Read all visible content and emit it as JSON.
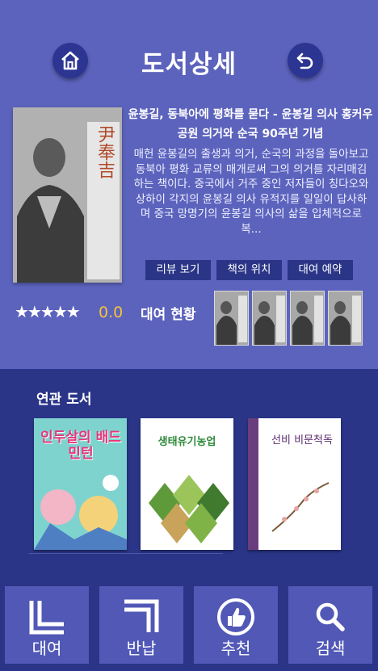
{
  "header": {
    "title": "도서상세"
  },
  "book": {
    "title": "윤봉길, 동북아에 평화를 묻다 - 윤봉길 의사 홍커우 공원 의거와 순국 90주년 기념",
    "description": "매헌 윤봉길의 출생과 의거, 순국의 과정을 돌아보고 동북아 평화 교류의 매개로써 그의 의거를 자리매김하는 책이다. 중국에서 거주 중인 저자들이 칭다오와 상하이 각지의 윤봉길 의사 유적지를 일일이 답사하며 중국 망명기의 윤봉길 의사의 삶을 입체적으로 복...",
    "cover_text": "尹奉吉"
  },
  "actions": {
    "review": "리뷰 보기",
    "location": "책의 위치",
    "reserve": "대여 예약"
  },
  "rating": {
    "stars": "★★★★★",
    "value": "0.0"
  },
  "rental_status_label": "대여 현황",
  "related": {
    "label": "연관 도서",
    "books": [
      {
        "cover_text": "인두살의 배드민턴"
      },
      {
        "cover_text": "생태유기농업"
      },
      {
        "cover_text": "선비 비문척독"
      }
    ]
  },
  "nav": {
    "rent": "대여",
    "return": "반납",
    "recommend": "추천",
    "search": "검색"
  },
  "colors": {
    "top_bg": "#5c63bd",
    "bottom_bg": "#2a3587",
    "accent": "#f7c23a"
  },
  "icons": [
    "home-icon",
    "back-icon",
    "star-icon",
    "rent-icon",
    "return-icon",
    "thumbs-up-icon",
    "search-icon"
  ]
}
